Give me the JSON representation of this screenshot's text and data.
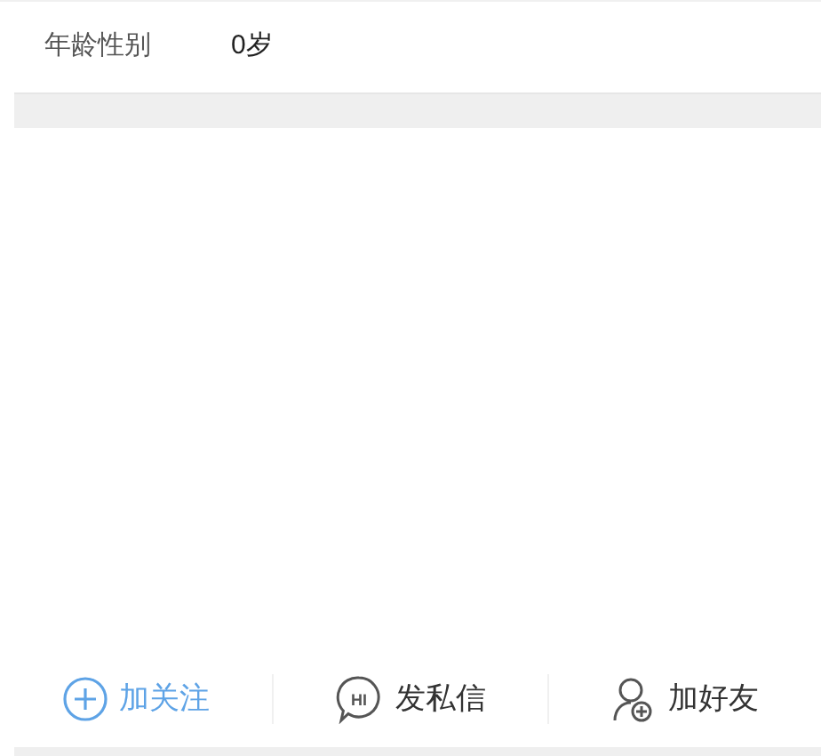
{
  "info_rows": [
    {
      "label": "年龄性别",
      "value": "0岁"
    }
  ],
  "actions": [
    {
      "kind": "follow",
      "label": "加关注"
    },
    {
      "kind": "message",
      "label": "发私信",
      "icon_text": "HI"
    },
    {
      "kind": "friend",
      "label": "加好友"
    }
  ]
}
